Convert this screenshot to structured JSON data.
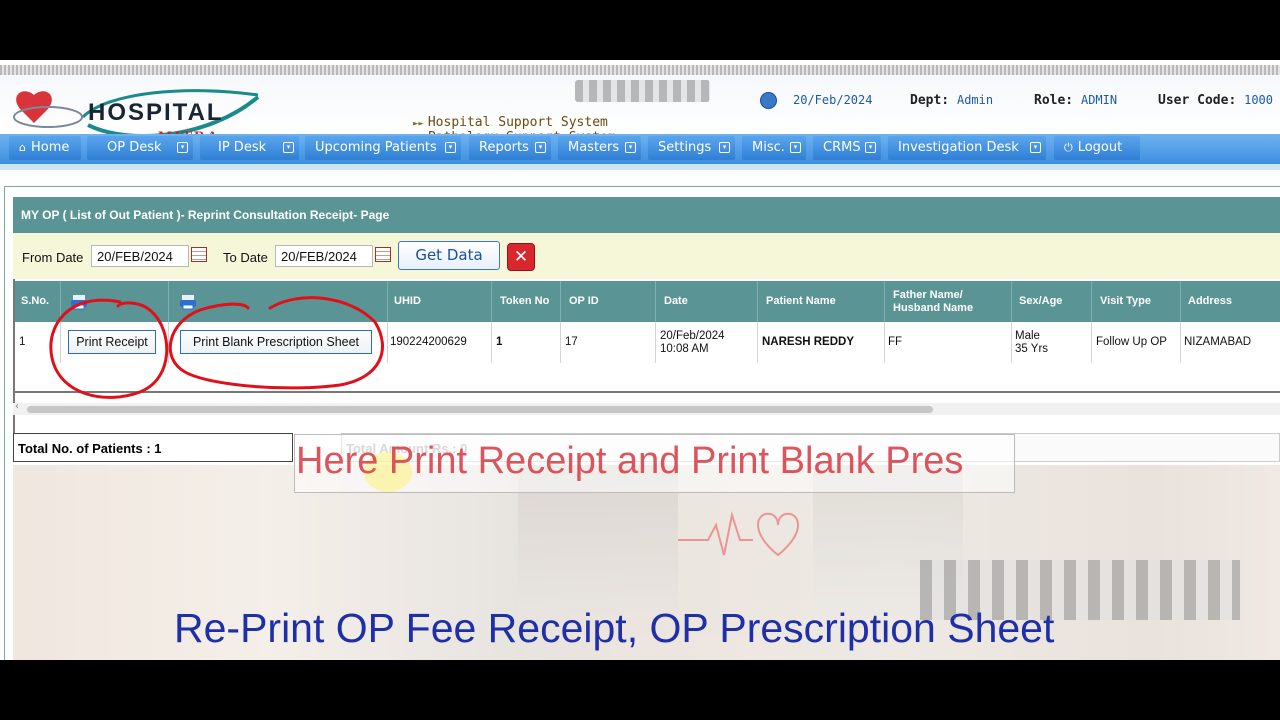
{
  "header": {
    "logo_main": "HOSPITAL",
    "logo_sub": "MITRA",
    "system_links": [
      "Hospital Support System",
      "Pathology Support System"
    ],
    "date": "20/Feb/2024",
    "dept_label": "Dept:",
    "dept_value": "Admin",
    "role_label": "Role:",
    "role_value": "ADMIN",
    "usercode_label": "User Code:",
    "usercode_value": "1000"
  },
  "nav": {
    "items": [
      {
        "label": "Home"
      },
      {
        "label": "OP Desk"
      },
      {
        "label": "IP Desk"
      },
      {
        "label": "Upcoming Patients"
      },
      {
        "label": "Reports"
      },
      {
        "label": "Masters"
      },
      {
        "label": "Settings"
      },
      {
        "label": "Misc."
      },
      {
        "label": "CRMS"
      },
      {
        "label": "Investigation Desk"
      },
      {
        "label": "Logout"
      }
    ]
  },
  "page": {
    "title": "MY OP ( List of Out Patient )- Reprint Consultation Receipt- Page"
  },
  "filters": {
    "from_label": "From Date",
    "from_value": "20/FEB/2024",
    "to_label": "To Date",
    "to_value": "20/FEB/2024",
    "get_data_label": "Get Data",
    "close_label": "✕"
  },
  "table": {
    "headers": {
      "sno": "S.No.",
      "uhid": "UHID",
      "token": "Token No",
      "opid": "OP ID",
      "date": "Date",
      "patient": "Patient Name",
      "father_line1": "Father Name/",
      "father_line2": "Husband Name",
      "sexage": "Sex/Age",
      "visit": "Visit Type",
      "address": "Address"
    },
    "rows": [
      {
        "sno": "1",
        "print_receipt": "Print Receipt",
        "print_blank": "Print Blank Prescription Sheet",
        "uhid": "190224200629",
        "token": "1",
        "opid": "17",
        "date_line1": "20/Feb/2024",
        "date_line2": "10:08 AM",
        "patient": "NARESH REDDY",
        "father": "FF",
        "sex": "Male",
        "age": "35 Yrs",
        "visit": "Follow Up OP",
        "address": "NIZAMABAD"
      }
    ]
  },
  "summary": {
    "total_patients": "Total No. of Patients : 1",
    "total_amount": "Total Amount Rs.: 0"
  },
  "overlay": {
    "caption": "Here Print Receipt and Print Blank Pres",
    "title": "Re-Print OP Fee Receipt, OP Prescription Sheet"
  },
  "colors": {
    "nav_blue": "#3c8fe0",
    "teal_header": "#5a9494",
    "filter_bg": "#f6f6d9",
    "annotation_red": "#e0101a",
    "title_blue": "#1f2fa8"
  }
}
